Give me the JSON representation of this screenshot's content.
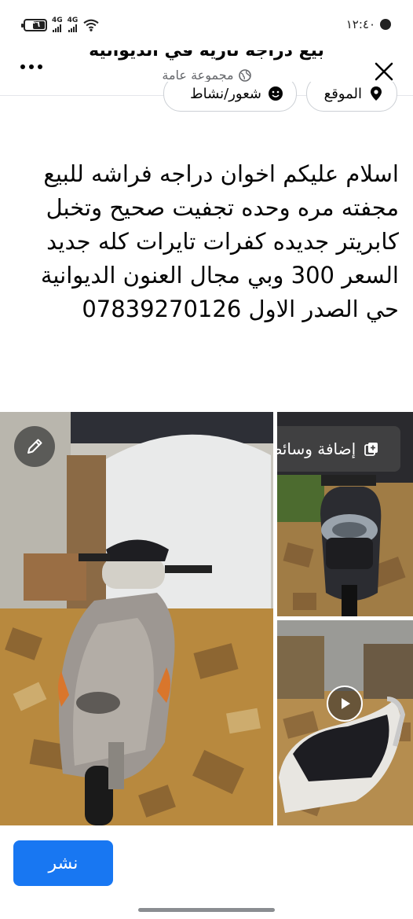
{
  "status_bar": {
    "time": "١٢:٤٠",
    "battery": "٣٦",
    "signal_1": "4G",
    "signal_2": "4G"
  },
  "header": {
    "title_fragment": "بيع دراجة نارية في الديوانية",
    "audience": "مجموعة عامة"
  },
  "chips": {
    "location": "الموقع",
    "feeling": "شعور/نشاط"
  },
  "post": {
    "lines": [
      "اسلام عليكم اخوان دراجه فراشه للبيع",
      "مجفته مره وحده تجفيت صحيح وتخبل",
      "كابريتر جديده كفرات تايرات كله جديد",
      "السعر 300 وبي مجال العنون الديوانية",
      "حي الصدر الاول 07839270126"
    ]
  },
  "media": {
    "add_media_label": "إضافة وسائط"
  },
  "actions": {
    "publish_label": "نشر"
  },
  "colors": {
    "accent": "#1877f2",
    "muted_text": "#65676b"
  }
}
